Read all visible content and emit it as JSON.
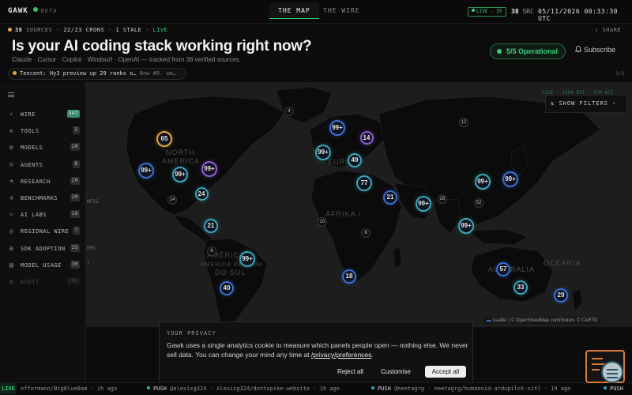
{
  "topbar": {
    "brand": "GAWK",
    "beta": "BETA",
    "tabs": [
      "THE MAP",
      "THE WIRE"
    ],
    "live_badge": "LIVE · 35",
    "src_count": "38",
    "src_label": "SRC",
    "datetime": "05/11/2026 00:33:30 UTC"
  },
  "status": {
    "sources_count": "38",
    "sources_label": "SOURCES",
    "crons": "22/23 CRONS",
    "stale": "1 STALE",
    "live": "LIVE",
    "share": "SHARE"
  },
  "hero": {
    "title": "Is your AI coding stack working right now?",
    "subtitle": "Claude · Cursor · Copilot · Windsurf · OpenAI — tracked from 38 verified sources.",
    "operational": "5/5 Operational",
    "subscribe": "Subscribe"
  },
  "ticker": {
    "headline": "Tencent: Hy3 preview up 29 ranks o…",
    "detail": "Now #9. wa…",
    "page": "1/3"
  },
  "map": {
    "clusters": [
      {
        "label": "65",
        "ring": "#e0a83a"
      },
      {
        "label": "99+",
        "ring": "#3a6fd8"
      },
      {
        "label": "99+",
        "ring": "#3aa7b8"
      },
      {
        "label": "99+",
        "ring": "#8f5ad8"
      },
      {
        "label": "24",
        "ring": "#3aa7b8"
      },
      {
        "label": "99+",
        "ring": "#3a6fd8"
      },
      {
        "label": "14",
        "ring": "#8f5ad8"
      },
      {
        "label": "99+",
        "ring": "#3aa7b8"
      },
      {
        "label": "49",
        "ring": "#3aa7b8"
      },
      {
        "label": "77",
        "ring": "#3aa7b8"
      },
      {
        "label": "21",
        "ring": "#3a6fd8"
      },
      {
        "label": "99+",
        "ring": "#3aa7b8"
      },
      {
        "label": "99+",
        "ring": "#3aa7b8"
      },
      {
        "label": "99+",
        "ring": "#3a6fd8"
      },
      {
        "label": "99+",
        "ring": "#3aa7b8"
      },
      {
        "label": "21",
        "ring": "#3aa7b8"
      },
      {
        "label": "99+",
        "ring": "#3aa7b8"
      },
      {
        "label": "40",
        "ring": "#3a6fd8"
      },
      {
        "label": "18",
        "ring": "#3a6fd8"
      },
      {
        "label": "57",
        "ring": "#3a6fd8"
      },
      {
        "label": "33",
        "ring": "#3aa7b8"
      },
      {
        "label": "29",
        "ring": "#3a6fd8"
      }
    ],
    "small_clusters": [
      "4",
      "12",
      "14",
      "26",
      "52",
      "10",
      "8",
      "6"
    ],
    "labels": [
      "NORTH",
      "AMERICA",
      "EUROPE",
      "AFRIKA /",
      "AMÉRICA",
      "DO SUL",
      "OCEANIA",
      "AUSTRALIA",
      "AMERICA DEL SUR"
    ],
    "show_filters": "SHOW FILTERS",
    "filters_peek": "LIVE · 1304 EXT · 57M ACT",
    "attribution": "Leaflet | © OpenStreetMap contributors © CARTO"
  },
  "sidebar": {
    "items": [
      {
        "icon": "wire-icon",
        "glyph": "⚡",
        "label": "WIRE",
        "count": "347",
        "hi": true
      },
      {
        "icon": "tools-icon",
        "glyph": "⚒",
        "label": "TOOLS",
        "count": "5"
      },
      {
        "icon": "models-icon",
        "glyph": "⚙",
        "label": "MODELS",
        "count": "20"
      },
      {
        "icon": "agents-icon",
        "glyph": "☺",
        "label": "AGENTS",
        "count": "8"
      },
      {
        "icon": "research-icon",
        "glyph": "⚗",
        "label": "RESEARCH",
        "count": "20"
      },
      {
        "icon": "benchmarks-icon",
        "glyph": "⚗",
        "label": "BENCHMARKS",
        "count": "20"
      },
      {
        "icon": "ai-labs-icon",
        "glyph": "⚛",
        "label": "AI LABS",
        "count": "16"
      },
      {
        "icon": "regional-wire-icon",
        "glyph": "◎",
        "label": "REGIONAL WIRE",
        "count": "7"
      },
      {
        "icon": "sdk-adoption-icon",
        "glyph": "⊞",
        "label": "SDK ADOPTION",
        "count": "25"
      },
      {
        "icon": "model-usage-icon",
        "glyph": "▤",
        "label": "MODEL USAGE",
        "count": "30"
      },
      {
        "icon": "audit-icon",
        "glyph": "▦",
        "label": "AUDIT",
        "count": "100",
        "faded": true
      }
    ],
    "peek": [
      "NFIG",
      "EMS",
      ")"
    ]
  },
  "privacy": {
    "title": "YOUR PRIVACY",
    "body": "Gawk uses a single analytics cookie to measure which panels people open — nothing else. We never sell data. You can change your mind any time at ",
    "link": "/privacy/preferences",
    "body_end": ".",
    "reject": "Reject all",
    "customise": "Customise",
    "accept": "Accept all"
  },
  "wire_bar": {
    "live": "LIVE",
    "items": [
      {
        "prefix": "",
        "text": "offermann/Big8lueBam · 1h ago"
      },
      {
        "prefix": "PUSH",
        "text": "@alexisg324 · Alexisg324/dontspike-website · 1h ago"
      },
      {
        "prefix": "PUSH",
        "text": "@neetagrg · neetagrg/humanoid-ardupilot-sitl · 1h ago"
      },
      {
        "prefix": "PUSH",
        "text": ""
      }
    ]
  },
  "colors": {
    "accent_green": "#3ad07a",
    "warning_amber": "#e0a83a",
    "cluster_blue": "#3a6fd8",
    "cluster_teal": "#3aa7b8",
    "cluster_purple": "#8f5ad8"
  }
}
